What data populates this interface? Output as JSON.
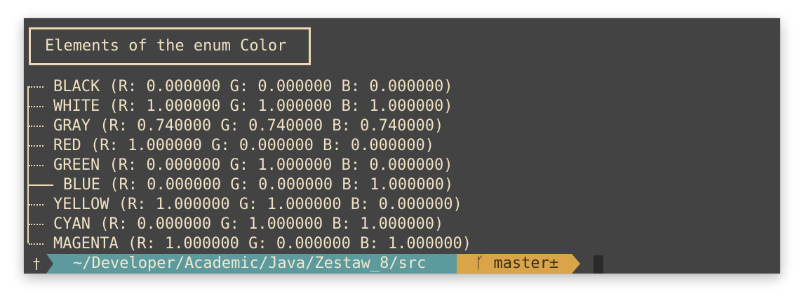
{
  "terminal": {
    "heading": "Elements of the enum Color",
    "rows": [
      {
        "text": "BLACK (R: 0.000000 G: 0.000000 B: 0.000000)",
        "selected": false
      },
      {
        "text": "WHITE (R: 1.000000 G: 1.000000 B: 1.000000)",
        "selected": false
      },
      {
        "text": "GRAY (R: 0.740000 G: 0.740000 B: 0.740000)",
        "selected": false
      },
      {
        "text": "RED (R: 1.000000 G: 0.000000 B: 0.000000)",
        "selected": false
      },
      {
        "text": "GREEN (R: 0.000000 G: 1.000000 B: 0.000000)",
        "selected": false
      },
      {
        "text": "BLUE (R: 0.000000 G: 0.000000 B: 1.000000)",
        "selected": true
      },
      {
        "text": "YELLOW (R: 1.000000 G: 1.000000 B: 0.000000)",
        "selected": false
      },
      {
        "text": "CYAN (R: 0.000000 G: 1.000000 B: 1.000000)",
        "selected": false
      },
      {
        "text": "MAGENTA (R: 1.000000 G: 0.000000 B: 1.000000)",
        "selected": false
      }
    ]
  },
  "prompt": {
    "symbol": "†",
    "path": "~/Developer/Academic/Java/Zestaw_8/src",
    "git_branch": "ᚴ master±"
  },
  "colors": {
    "background": "#434343",
    "text": "#efe1c3",
    "path_segment": "#5d9a9e",
    "git_segment": "#d9a548"
  }
}
